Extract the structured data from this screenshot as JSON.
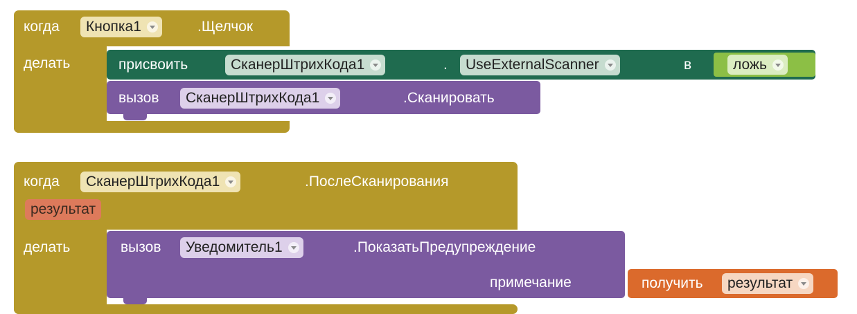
{
  "block1": {
    "when": "когда",
    "component": "Кнопка1",
    "event": ".Щелчок",
    "do": "делать",
    "set_kw": "присвоить",
    "set_component": "СканерШтрихКода1",
    "dot": ".",
    "set_property": "UseExternalScanner",
    "to": "в",
    "value": "ложь",
    "call_kw": "вызов",
    "call_component": "СканерШтрихКода1",
    "call_method": ".Сканировать"
  },
  "block2": {
    "when": "когда",
    "component": "СканерШтрихКода1",
    "event": ".ПослеСканирования",
    "param": "результат",
    "do": "делать",
    "call_kw": "вызов",
    "call_component": "Уведомитель1",
    "call_method": ".ПоказатьПредупреждение",
    "arg_label": "примечание",
    "get_kw": "получить",
    "get_var": "результат"
  },
  "colors": {
    "event": "#b5992a",
    "procedure": "#7b5aa0",
    "setter": "#1f6b4f",
    "logic": "#8cbf45",
    "getter": "#db6a2c"
  }
}
